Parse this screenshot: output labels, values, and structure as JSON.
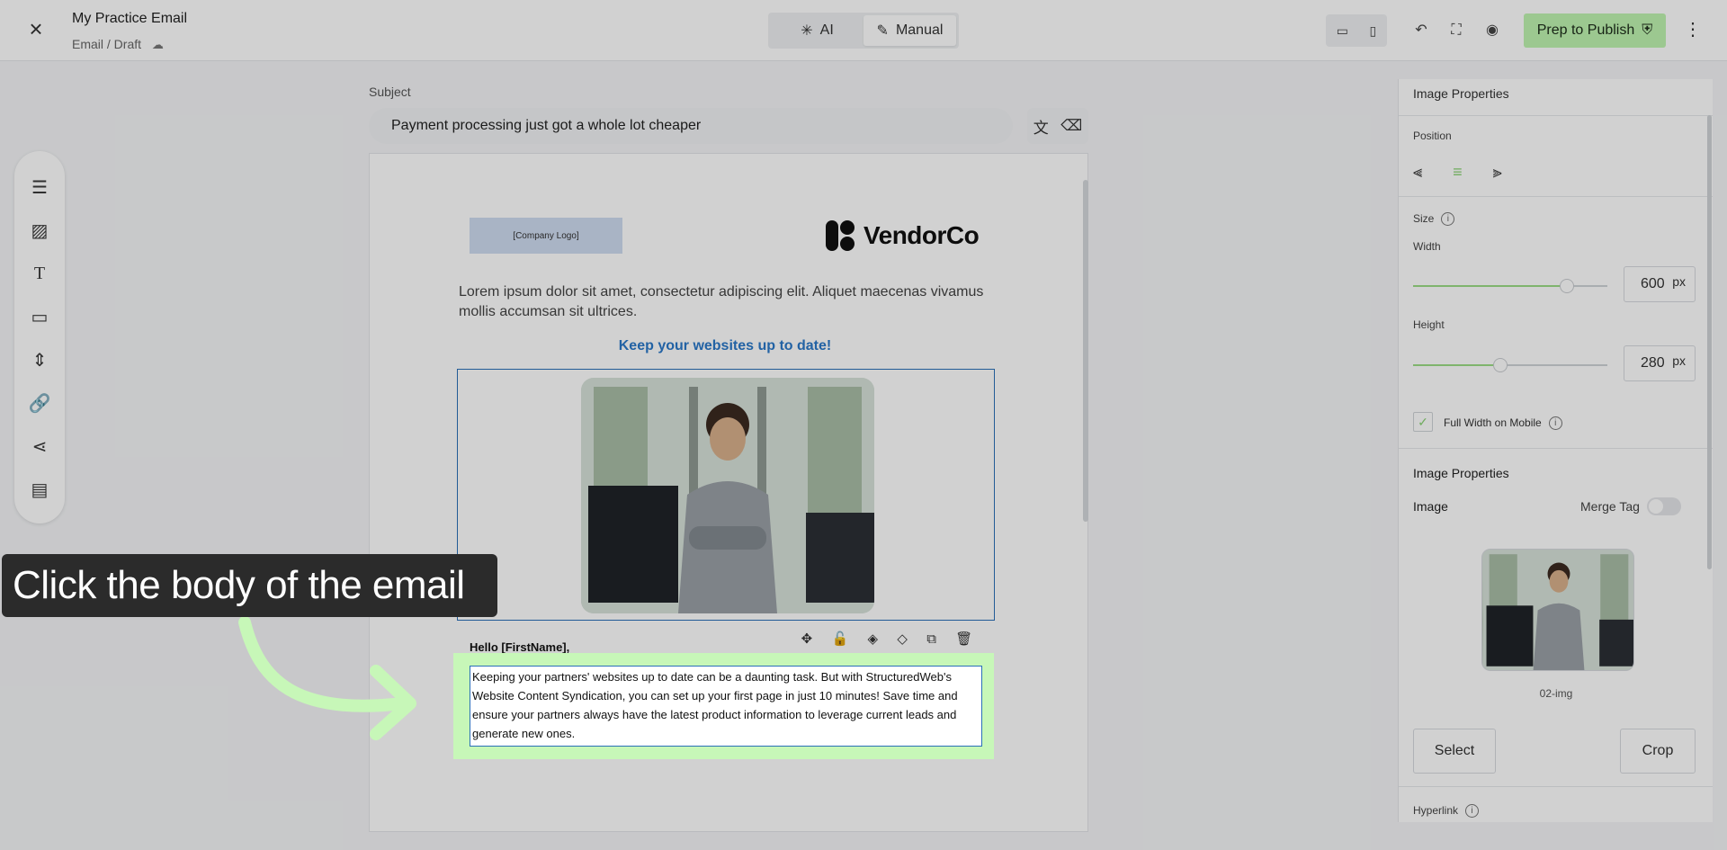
{
  "topbar": {
    "title": "My Practice Email",
    "breadcrumb": "Email / Draft",
    "modes": [
      "AI",
      "Manual"
    ],
    "active_mode": "Manual",
    "publish_label": "Prep to Publish"
  },
  "left_tools": [
    "rows-icon",
    "image-icon",
    "text-icon",
    "button-icon",
    "spacer-icon",
    "link-icon",
    "share-icon",
    "footer-icon"
  ],
  "subject": {
    "label": "Subject",
    "value": "Payment processing just got a whole lot cheaper"
  },
  "email": {
    "logo_placeholder": "[Company Logo]",
    "vendor_name": "VendorCo",
    "lorem": "Lorem ipsum dolor sit amet, consectetur adipiscing elit. Aliquet maecenas vivamus mollis accumsan sit ultrices.",
    "headline": "Keep your websites up to date!",
    "hello": "Hello [FirstName],",
    "body": "Keeping your partners' websites up to date can be a daunting task. But with StructuredWeb's Website Content Syndication, you can set up your first page in just 10 minutes! Save time and ensure your partners always have the latest product information to leverage current leads and generate new ones."
  },
  "panel": {
    "title": "Image Properties",
    "position_label": "Position",
    "size_label": "Size",
    "width_label": "Width",
    "width_value": "600",
    "height_label": "Height",
    "height_value": "280",
    "unit": "px",
    "width_fraction": 0.79,
    "height_fraction": 0.45,
    "full_width_label": "Full Width on Mobile",
    "full_width_checked": true,
    "section2_title": "Image Properties",
    "image_label": "Image",
    "merge_tag_label": "Merge Tag",
    "image_name": "02-img",
    "select_label": "Select",
    "crop_label": "Crop",
    "hyperlink_label": "Hyperlink"
  },
  "callout": {
    "text": "Click the body of the email"
  },
  "colors": {
    "accent_green": "#bff5b0",
    "link_blue": "#2a78c8"
  }
}
